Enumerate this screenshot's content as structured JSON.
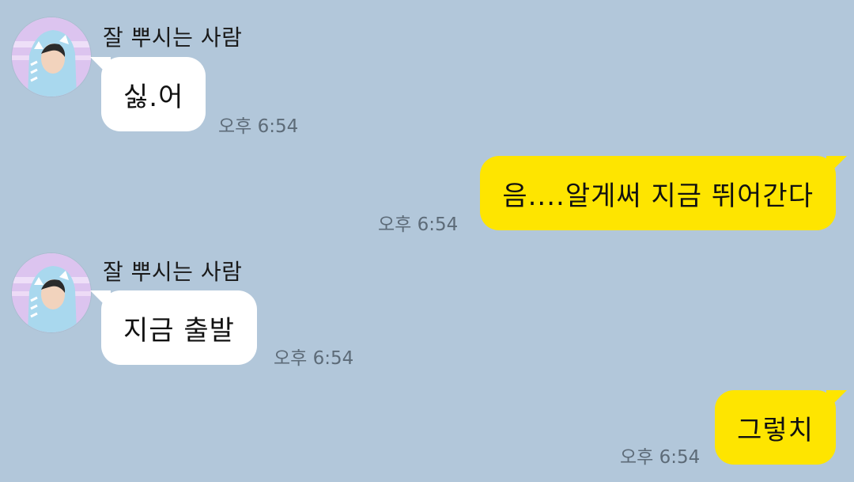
{
  "messages": [
    {
      "sender": "잘 뿌시는 사람",
      "text": "싫.어",
      "time": "오후 6:54",
      "direction": "in"
    },
    {
      "text": "음....알게써 지금 뛰어간다",
      "time": "오후 6:54",
      "direction": "out"
    },
    {
      "sender": "잘 뿌시는 사람",
      "text": "지금 출발",
      "time": "오후 6:54",
      "direction": "in"
    },
    {
      "text": "그렇치",
      "time": "오후 6:54",
      "direction": "out"
    }
  ],
  "colors": {
    "background": "#b2c7da",
    "incoming_bubble": "#ffffff",
    "outgoing_bubble": "#fee500",
    "timestamp": "#5d6b78"
  }
}
